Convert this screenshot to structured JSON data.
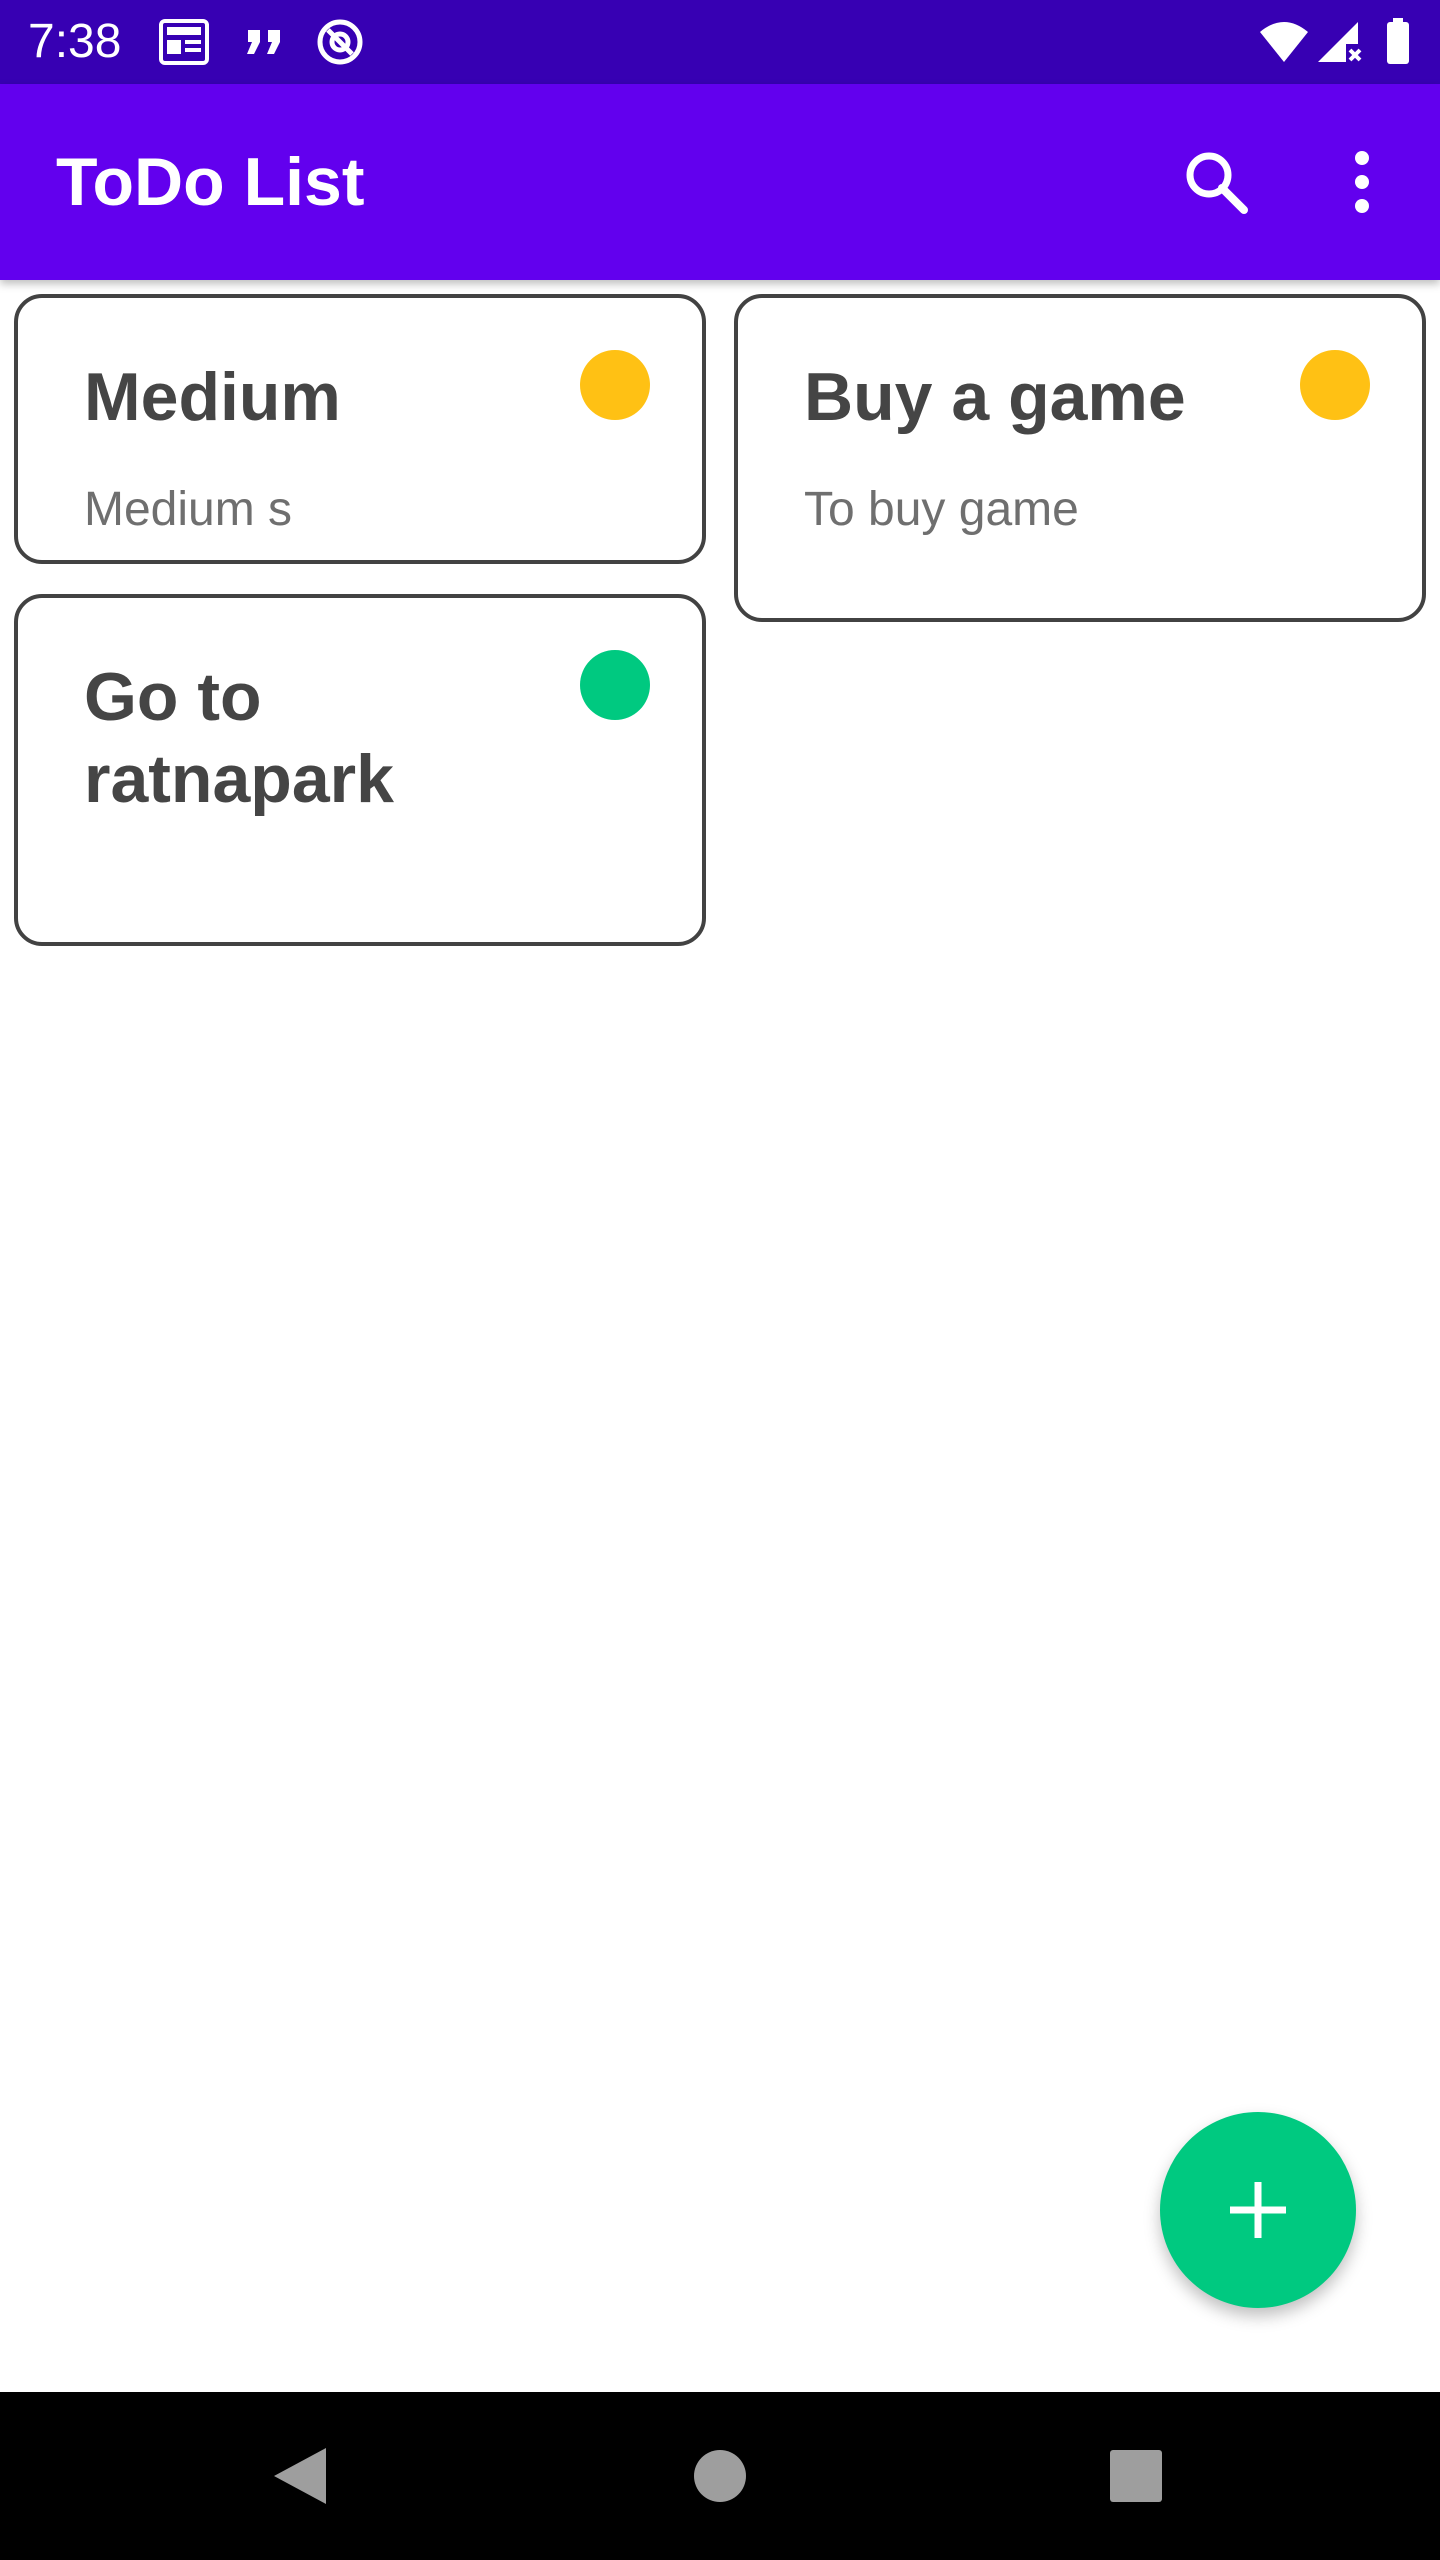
{
  "status_bar": {
    "time": "7:38",
    "left_icons": [
      "news-icon",
      "quote-icon",
      "at-sign-icon"
    ],
    "right_icons": [
      "wifi-icon",
      "signal-icon",
      "battery-icon"
    ]
  },
  "app_bar": {
    "title": "ToDo List",
    "actions": [
      "search-icon",
      "more-vert-icon"
    ]
  },
  "notes": [
    {
      "title": "Medium",
      "description": "Medium s",
      "priority_color": "#ffc114"
    },
    {
      "title": "Buy a game",
      "description": "To buy game",
      "priority_color": "#ffc114"
    },
    {
      "title": "Go to ratnapark",
      "description": "",
      "priority_color": "#00c980"
    }
  ],
  "fab": {
    "icon": "add-icon",
    "color": "#00c980"
  },
  "colors": {
    "status_bar": "#3700b3",
    "app_bar": "#6200ee",
    "card_border": "#424242"
  },
  "nav_bar": {
    "buttons": [
      "back-icon",
      "home-icon",
      "recents-icon"
    ]
  }
}
